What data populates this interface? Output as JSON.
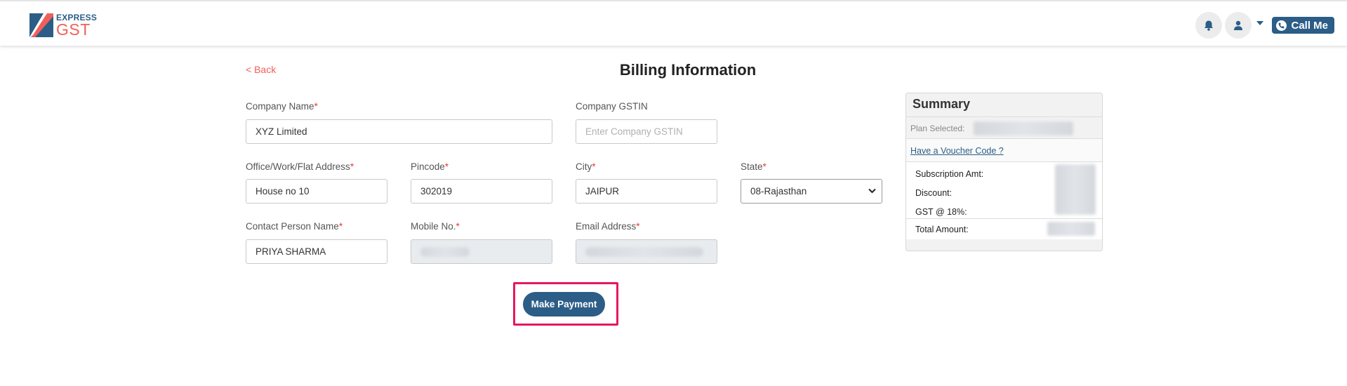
{
  "header": {
    "logo_top": "EXPRESS",
    "logo_bottom": "GST",
    "call_me_label": "Call Me"
  },
  "page": {
    "back_label": "< Back",
    "title": "Billing Information"
  },
  "form": {
    "company_name": {
      "label": "Company Name",
      "required": "*",
      "value": "XYZ Limited"
    },
    "company_gstin": {
      "label": "Company GSTIN",
      "placeholder": "Enter Company GSTIN"
    },
    "address": {
      "label": "Office/Work/Flat Address",
      "required": "*",
      "value": "House no 10"
    },
    "pincode": {
      "label": "Pincode",
      "required": "*",
      "value": "302019"
    },
    "city": {
      "label": "City",
      "required": "*",
      "value": "JAIPUR"
    },
    "state": {
      "label": "State",
      "required": "*",
      "value": "08-Rajasthan"
    },
    "contact_person": {
      "label": "Contact Person Name",
      "required": "*",
      "value": "PRIYA SHARMA"
    },
    "mobile": {
      "label": "Mobile No.",
      "required": "*"
    },
    "email": {
      "label": "Email Address",
      "required": "*"
    },
    "submit_label": "Make Payment"
  },
  "summary": {
    "title": "Summary",
    "plan_selected_label": "Plan Selected:",
    "voucher_link": "Have a Voucher Code ?",
    "subscription_label": "Subscription Amt:",
    "discount_label": "Discount:",
    "gst_label": "GST @ 18%:",
    "total_label": "Total Amount:"
  },
  "colors": {
    "brand_blue": "#2b5d87",
    "brand_red": "#f0605a",
    "highlight": "#e8175d"
  }
}
